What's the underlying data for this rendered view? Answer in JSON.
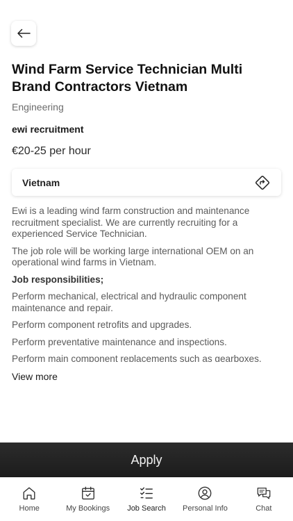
{
  "header": {
    "back_icon": "arrow-left-icon"
  },
  "job": {
    "title": "Wind Farm Service Technician Multi Brand Contractors Vietnam",
    "category": "Engineering",
    "company": "ewi recruitment",
    "salary": "€20-25 per hour",
    "location": "Vietnam",
    "directions_icon": "directions-icon"
  },
  "description": {
    "paragraph1": "Ewi is a leading wind farm construction and maintenance recruitment specialist. We are currently recruiting for a experienced Service Technician.",
    "paragraph2": "The job role will be working large international OEM on an operational wind farms in Vietnam.",
    "heading": "Job responsibilities;",
    "items": [
      "Perform mechanical, electrical and hydraulic component maintenance and repair.",
      "Perform component retrofits and upgrades.",
      "Perform preventative maintenance and inspections.",
      "Perform main component replacements such as gearboxes,"
    ],
    "view_more": "View more"
  },
  "apply": {
    "label": "Apply"
  },
  "tabs": [
    {
      "label": "Home",
      "icon": "home-icon",
      "active": false
    },
    {
      "label": "My Bookings",
      "icon": "calendar-icon",
      "active": false
    },
    {
      "label": "Job Search",
      "icon": "checklist-icon",
      "active": true
    },
    {
      "label": "Personal Info",
      "icon": "user-icon",
      "active": false
    },
    {
      "label": "Chat",
      "icon": "chat-icon",
      "active": false
    }
  ]
}
